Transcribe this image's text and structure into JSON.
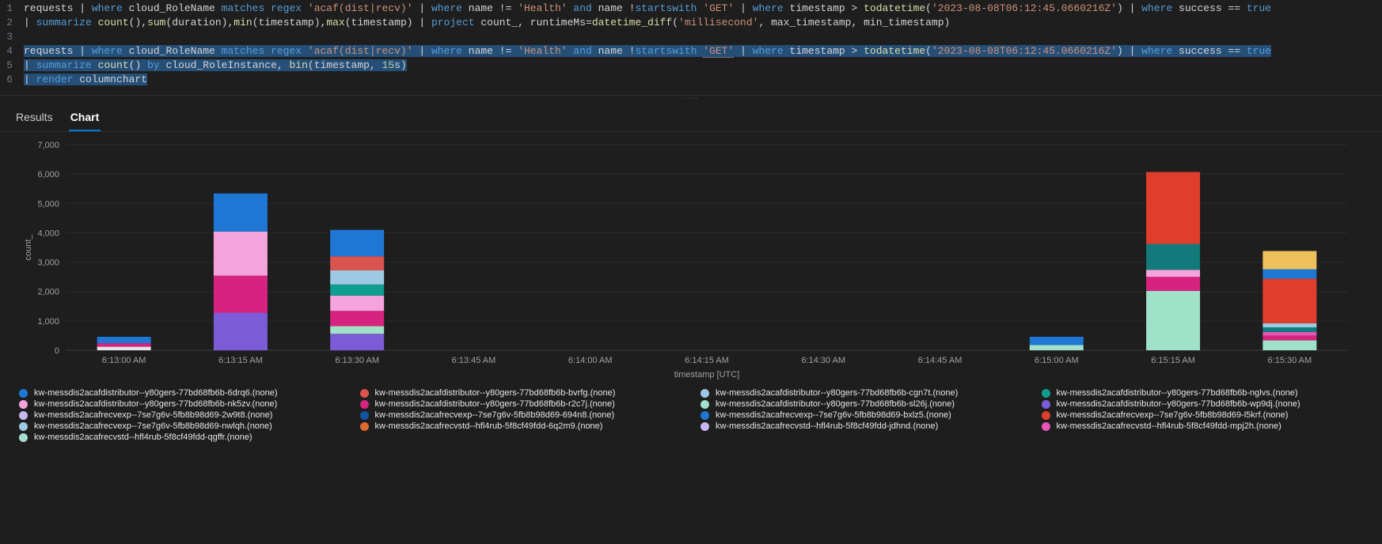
{
  "editor": {
    "lines": [
      {
        "no": "1",
        "tokens": [
          {
            "t": "requests ",
            "c": "id"
          },
          {
            "t": "| ",
            "c": "pipe"
          },
          {
            "t": "where",
            "c": "kw"
          },
          {
            "t": " cloud_RoleName ",
            "c": "id"
          },
          {
            "t": "matches regex",
            "c": "kw"
          },
          {
            "t": " ",
            "c": "id"
          },
          {
            "t": "'acaf(dist|recv)'",
            "c": "str"
          },
          {
            "t": " ",
            "c": "id"
          },
          {
            "t": "| ",
            "c": "pipe"
          },
          {
            "t": "where",
            "c": "kw"
          },
          {
            "t": " name != ",
            "c": "id"
          },
          {
            "t": "'Health'",
            "c": "str"
          },
          {
            "t": " ",
            "c": "id"
          },
          {
            "t": "and",
            "c": "kw"
          },
          {
            "t": " name !",
            "c": "id"
          },
          {
            "t": "startswith",
            "c": "kw"
          },
          {
            "t": " ",
            "c": "id"
          },
          {
            "t": "'GET'",
            "c": "str"
          },
          {
            "t": " ",
            "c": "id"
          },
          {
            "t": "| ",
            "c": "pipe"
          },
          {
            "t": "where",
            "c": "kw"
          },
          {
            "t": " timestamp > ",
            "c": "id"
          },
          {
            "t": "todatetime",
            "c": "fn"
          },
          {
            "t": "(",
            "c": "op"
          },
          {
            "t": "'2023-08-08T06:12:45.0660216Z'",
            "c": "str"
          },
          {
            "t": ") ",
            "c": "op"
          },
          {
            "t": "| ",
            "c": "pipe"
          },
          {
            "t": "where",
            "c": "kw"
          },
          {
            "t": " success == ",
            "c": "id"
          },
          {
            "t": "true",
            "c": "kw"
          }
        ]
      },
      {
        "no": "2",
        "tokens": [
          {
            "t": "| ",
            "c": "pipe"
          },
          {
            "t": "summarize",
            "c": "kw"
          },
          {
            "t": " ",
            "c": "id"
          },
          {
            "t": "count",
            "c": "fn"
          },
          {
            "t": "(),",
            "c": "op"
          },
          {
            "t": "sum",
            "c": "fn"
          },
          {
            "t": "(duration),",
            "c": "op"
          },
          {
            "t": "min",
            "c": "fn"
          },
          {
            "t": "(timestamp),",
            "c": "op"
          },
          {
            "t": "max",
            "c": "fn"
          },
          {
            "t": "(timestamp) ",
            "c": "op"
          },
          {
            "t": "| ",
            "c": "pipe"
          },
          {
            "t": "project",
            "c": "kw"
          },
          {
            "t": " count_, runtimeMs=",
            "c": "id"
          },
          {
            "t": "datetime_diff",
            "c": "fn"
          },
          {
            "t": "(",
            "c": "op"
          },
          {
            "t": "'millisecond'",
            "c": "str"
          },
          {
            "t": ", max_timestamp, min_timestamp)",
            "c": "op"
          }
        ]
      },
      {
        "no": "3",
        "tokens": []
      },
      {
        "no": "4",
        "sel": true,
        "tokens": [
          {
            "t": "requests ",
            "c": "id"
          },
          {
            "t": "| ",
            "c": "pipe"
          },
          {
            "t": "where",
            "c": "kw"
          },
          {
            "t": " cloud_RoleName ",
            "c": "id"
          },
          {
            "t": "matches regex",
            "c": "kw"
          },
          {
            "t": " ",
            "c": "id"
          },
          {
            "t": "'acaf(dist|recv)'",
            "c": "str"
          },
          {
            "t": " ",
            "c": "id"
          },
          {
            "t": "| ",
            "c": "pipe"
          },
          {
            "t": "where",
            "c": "kw"
          },
          {
            "t": " name != ",
            "c": "id"
          },
          {
            "t": "'Health'",
            "c": "str"
          },
          {
            "t": " ",
            "c": "id"
          },
          {
            "t": "and",
            "c": "kw"
          },
          {
            "t": " name !",
            "c": "id"
          },
          {
            "t": "startswith",
            "c": "kw"
          },
          {
            "t": " ",
            "c": "id"
          },
          {
            "t": "'GET'",
            "c": "str under"
          },
          {
            "t": " ",
            "c": "id"
          },
          {
            "t": "| ",
            "c": "pipe"
          },
          {
            "t": "where",
            "c": "kw"
          },
          {
            "t": " timestamp > ",
            "c": "id"
          },
          {
            "t": "todatetime",
            "c": "fn"
          },
          {
            "t": "(",
            "c": "op"
          },
          {
            "t": "'2023-08-08T06:12:45.0660216Z'",
            "c": "str"
          },
          {
            "t": ") ",
            "c": "op"
          },
          {
            "t": "| ",
            "c": "pipe"
          },
          {
            "t": "where",
            "c": "kw"
          },
          {
            "t": " success == ",
            "c": "id"
          },
          {
            "t": "true",
            "c": "kw"
          }
        ]
      },
      {
        "no": "5",
        "sel": true,
        "tokens": [
          {
            "t": "| ",
            "c": "pipe"
          },
          {
            "t": "summarize",
            "c": "kw"
          },
          {
            "t": " ",
            "c": "id"
          },
          {
            "t": "count",
            "c": "fn"
          },
          {
            "t": "() ",
            "c": "op"
          },
          {
            "t": "by",
            "c": "kw"
          },
          {
            "t": " cloud_RoleInstance, ",
            "c": "id"
          },
          {
            "t": "bin",
            "c": "fn"
          },
          {
            "t": "(timestamp, ",
            "c": "op"
          },
          {
            "t": "15",
            "c": "num"
          },
          {
            "t": "s)",
            "c": "op"
          }
        ]
      },
      {
        "no": "6",
        "sel": true,
        "tokens": [
          {
            "t": "| ",
            "c": "pipe"
          },
          {
            "t": "render",
            "c": "kw"
          },
          {
            "t": " columnchart",
            "c": "id"
          }
        ]
      }
    ]
  },
  "tabs": {
    "results": "Results",
    "chart": "Chart",
    "active": "chart"
  },
  "colors": {
    "blue": "#1f77d4",
    "orange": "#d9534f",
    "lightblue": "#9ec9e2",
    "teal": "#0f9d8f",
    "pink": "#f5a3dc",
    "magenta": "#d6237f",
    "mint": "#9fe2c9",
    "purple": "#7c5bd6",
    "lilac": "#c6b6f2",
    "darkblue": "#1752a3",
    "red": "#e03e2d",
    "tealdk": "#127a7a",
    "white": "#e6e6e6",
    "orangey": "#e06933",
    "mpink": "#e455b5",
    "salmon": "#d65a5a",
    "skint": "#a8ded1",
    "gold": "#eec05a"
  },
  "legend": [
    {
      "colorKey": "blue",
      "label": "kw-messdis2acafdistributor--y80gers-77bd68fb6b-6drq6.(none)"
    },
    {
      "colorKey": "orange",
      "label": "kw-messdis2acafdistributor--y80gers-77bd68fb6b-bvrfg.(none)"
    },
    {
      "colorKey": "lightblue",
      "label": "kw-messdis2acafdistributor--y80gers-77bd68fb6b-cgn7t.(none)"
    },
    {
      "colorKey": "teal",
      "label": "kw-messdis2acafdistributor--y80gers-77bd68fb6b-nglvs.(none)"
    },
    {
      "colorKey": "pink",
      "label": "kw-messdis2acafdistributor--y80gers-77bd68fb6b-nk5zv.(none)"
    },
    {
      "colorKey": "magenta",
      "label": "kw-messdis2acafdistributor--y80gers-77bd68fb6b-r2c7j.(none)"
    },
    {
      "colorKey": "mint",
      "label": "kw-messdis2acafdistributor--y80gers-77bd68fb6b-sl26j.(none)"
    },
    {
      "colorKey": "purple",
      "label": "kw-messdis2acafdistributor--y80gers-77bd68fb6b-wp9dj.(none)"
    },
    {
      "colorKey": "lilac",
      "label": "kw-messdis2acafrecvexp--7se7g6v-5fb8b98d69-2w9t8.(none)"
    },
    {
      "colorKey": "darkblue",
      "label": "kw-messdis2acafrecvexp--7se7g6v-5fb8b98d69-694n8.(none)"
    },
    {
      "colorKey": "blue",
      "label": "kw-messdis2acafrecvexp--7se7g6v-5fb8b98d69-bxlz5.(none)"
    },
    {
      "colorKey": "red",
      "label": "kw-messdis2acafrecvexp--7se7g6v-5fb8b98d69-l5krf.(none)"
    },
    {
      "colorKey": "lightblue",
      "label": "kw-messdis2acafrecvexp--7se7g6v-5fb8b98d69-nwlqh.(none)"
    },
    {
      "colorKey": "orangey",
      "label": "kw-messdis2acafrecvstd--hfl4rub-5f8cf49fdd-6q2m9.(none)"
    },
    {
      "colorKey": "lilac",
      "label": "kw-messdis2acafrecvstd--hfl4rub-5f8cf49fdd-jdhnd.(none)"
    },
    {
      "colorKey": "mpink",
      "label": "kw-messdis2acafrecvstd--hfl4rub-5f8cf49fdd-mpj2h.(none)"
    },
    {
      "colorKey": "skint",
      "label": "kw-messdis2acafrecvstd--hfl4rub-5f8cf49fdd-qgffr.(none)"
    }
  ],
  "chart_data": {
    "type": "bar",
    "stacked": true,
    "title": "",
    "xlabel": "timestamp [UTC]",
    "ylabel": "count_",
    "ylim": [
      0,
      7000
    ],
    "yticks": [
      0,
      1000,
      2000,
      3000,
      4000,
      5000,
      6000,
      7000
    ],
    "yticklabels": [
      "0",
      "1,000",
      "2,000",
      "3,000",
      "4,000",
      "5,000",
      "6,000",
      "7,000"
    ],
    "categories": [
      "6:13:00 AM",
      "6:13:15 AM",
      "6:13:30 AM",
      "6:13:45 AM",
      "6:14:00 AM",
      "6:14:15 AM",
      "6:14:30 AM",
      "6:14:45 AM",
      "6:15:00 AM",
      "6:15:15 AM",
      "6:15:30 AM"
    ],
    "stacks": [
      [
        {
          "colorKey": "white",
          "v": 120
        },
        {
          "colorKey": "magenta",
          "v": 120
        },
        {
          "colorKey": "blue",
          "v": 220
        }
      ],
      [
        {
          "colorKey": "purple",
          "v": 1280
        },
        {
          "colorKey": "magenta",
          "v": 1260
        },
        {
          "colorKey": "pink",
          "v": 1500
        },
        {
          "colorKey": "blue",
          "v": 1300
        }
      ],
      [
        {
          "colorKey": "purple",
          "v": 560
        },
        {
          "colorKey": "mint",
          "v": 260
        },
        {
          "colorKey": "magenta",
          "v": 520
        },
        {
          "colorKey": "pink",
          "v": 520
        },
        {
          "colorKey": "teal",
          "v": 380
        },
        {
          "colorKey": "lightblue",
          "v": 480
        },
        {
          "colorKey": "orange",
          "v": 480
        },
        {
          "colorKey": "blue",
          "v": 900
        }
      ],
      [],
      [],
      [],
      [],
      [],
      [
        {
          "colorKey": "mint",
          "v": 180
        },
        {
          "colorKey": "blue",
          "v": 280
        }
      ],
      [
        {
          "colorKey": "mint",
          "v": 2020
        },
        {
          "colorKey": "magenta",
          "v": 480
        },
        {
          "colorKey": "pink",
          "v": 240
        },
        {
          "colorKey": "tealdk",
          "v": 880
        },
        {
          "colorKey": "red",
          "v": 2450
        }
      ],
      [
        {
          "colorKey": "mint",
          "v": 340
        },
        {
          "colorKey": "magenta",
          "v": 160
        },
        {
          "colorKey": "mpink",
          "v": 120
        },
        {
          "colorKey": "tealdk",
          "v": 160
        },
        {
          "colorKey": "lightblue",
          "v": 140
        },
        {
          "colorKey": "red",
          "v": 1520
        },
        {
          "colorKey": "blue",
          "v": 320
        },
        {
          "colorKey": "gold",
          "v": 620
        }
      ]
    ]
  }
}
